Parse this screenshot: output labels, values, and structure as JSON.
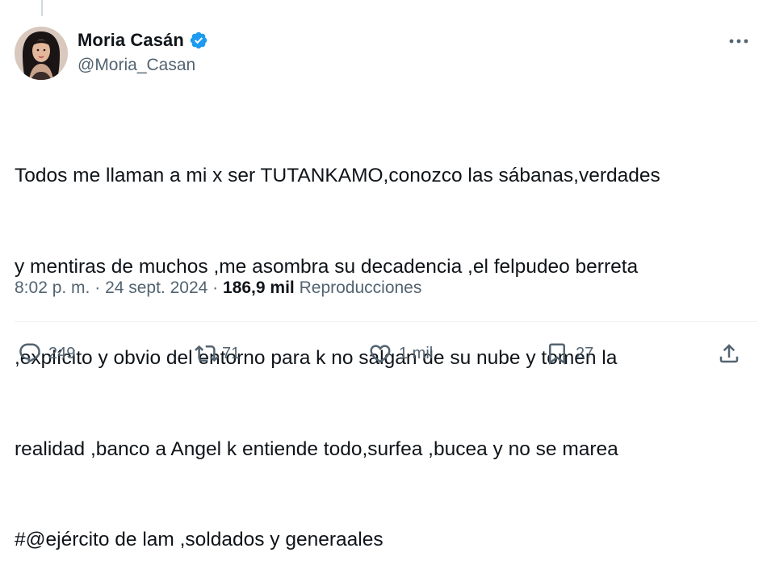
{
  "author": {
    "display_name": "Moria Casán",
    "handle": "@Moria_Casan",
    "verified": true,
    "verified_color": "#1d9bf0"
  },
  "tweet": {
    "lines": [
      "Todos me llaman a mi x ser TUTANKAMO,conozco las sábanas,verdades",
      "y mentiras de muchos ,me asombra su decadencia ,el felpudeo berreta",
      ",explícito y obvio del entorno para k no salgan de su nube y tomen la",
      "realidad ,banco a Angel k entiende todo,surfea ,bucea y no se marea",
      "#@ejército de lam ,soldados y generaales"
    ]
  },
  "meta": {
    "time": "8:02 p. m.",
    "separator": " · ",
    "date": "24 sept. 2024",
    "views_count": "186,9 mil",
    "views_label": "Reproducciones"
  },
  "actions": {
    "replies": "249",
    "reposts": "71",
    "likes": "1 mil",
    "bookmarks": "27"
  },
  "icons": {
    "more": "more-horizontal-icon",
    "reply": "reply-icon",
    "repost": "repost-icon",
    "like": "heart-icon",
    "bookmark": "bookmark-icon",
    "share": "share-icon"
  }
}
